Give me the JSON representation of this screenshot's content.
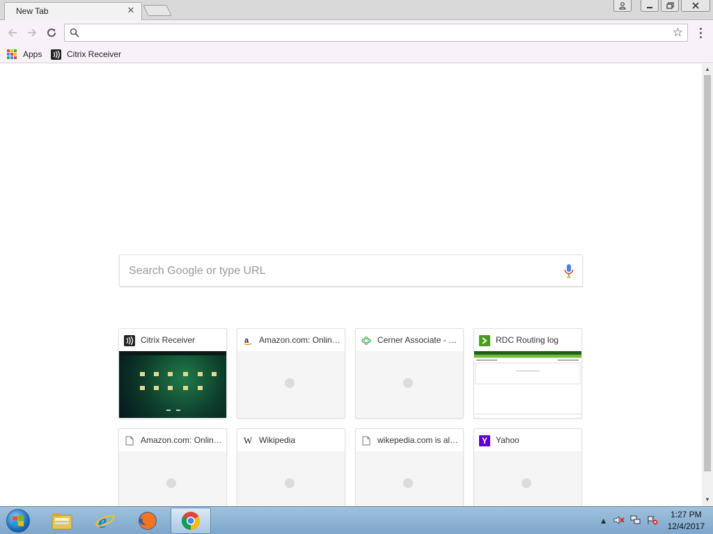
{
  "tab": {
    "title": "New Tab",
    "close": "✕"
  },
  "window": {
    "minimize": "—",
    "maximize": "❐",
    "close": "✕"
  },
  "omnibox": {
    "value": "",
    "placeholder": ""
  },
  "bookmarks": [
    {
      "label": "Apps",
      "icon": "apps-grid-icon"
    },
    {
      "label": "Citrix Receiver",
      "icon": "citrix-icon"
    }
  ],
  "ntp": {
    "search_placeholder": "Search Google or type URL",
    "tiles": [
      {
        "title": "Citrix Receiver",
        "favicon": "citrix-icon",
        "thumb": "citrix"
      },
      {
        "title": "Amazon.com: Online Shopping",
        "favicon": "amazon-icon",
        "thumb": "blank"
      },
      {
        "title": "Cerner Associate - Home",
        "favicon": "cerner-icon",
        "thumb": "blank"
      },
      {
        "title": "RDC Routing log",
        "favicon": "rdc-icon",
        "thumb": "rdc"
      },
      {
        "title": "Amazon.com: Online Shopping",
        "favicon": "page-icon",
        "thumb": "blank"
      },
      {
        "title": "Wikipedia",
        "favicon": "wikipedia-icon",
        "thumb": "blank"
      },
      {
        "title": "wikepedia.com is alright",
        "favicon": "page-icon",
        "thumb": "blank"
      },
      {
        "title": "Yahoo",
        "favicon": "yahoo-icon",
        "thumb": "blank"
      }
    ]
  },
  "taskbar": {
    "time": "1:27 PM",
    "date": "12/4/2017",
    "apps": [
      "windows-explorer-icon",
      "internet-explorer-icon",
      "firefox-icon",
      "chrome-icon"
    ]
  },
  "colors": {
    "accent": "#4285f4",
    "toolbar": "#f7f2f7",
    "taskbar": "#8fb4d6"
  }
}
